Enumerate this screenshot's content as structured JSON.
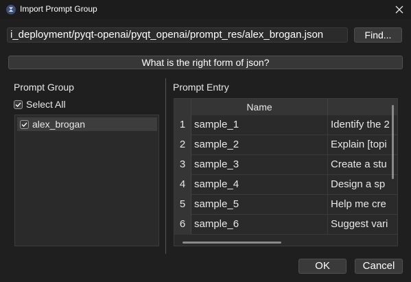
{
  "window": {
    "title": "Import Prompt Group",
    "icon": "openai-logo-icon"
  },
  "file_path": {
    "value": "i_deployment/pyqt-openai/pyqt_openai/prompt_res/alex_brogan.json"
  },
  "find_label": "Find...",
  "help_label": "What is the right form of json?",
  "prompt_group": {
    "title": "Prompt Group",
    "select_all_label": "Select All",
    "items": [
      {
        "label": "alex_brogan",
        "checked": true
      }
    ]
  },
  "prompt_entry": {
    "title": "Prompt Entry",
    "columns": [
      "",
      "Name",
      ""
    ],
    "rows": [
      {
        "num": "1",
        "name": "sample_1",
        "entry": "Identify the 2"
      },
      {
        "num": "2",
        "name": "sample_2",
        "entry": "Explain [topi"
      },
      {
        "num": "3",
        "name": "sample_3",
        "entry": "Create a stu"
      },
      {
        "num": "4",
        "name": "sample_4",
        "entry": "Design a sp"
      },
      {
        "num": "5",
        "name": "sample_5",
        "entry": "Help me cre"
      },
      {
        "num": "6",
        "name": "sample_6",
        "entry": "Suggest vari"
      }
    ]
  },
  "buttons": {
    "ok": "OK",
    "cancel": "Cancel"
  }
}
